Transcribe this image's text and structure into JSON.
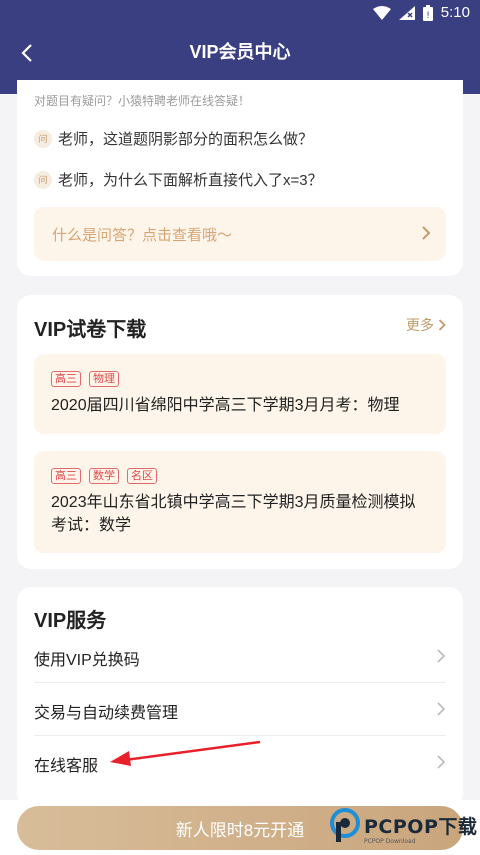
{
  "status_bar": {
    "time": "5:10"
  },
  "navbar": {
    "title": "VIP会员中心"
  },
  "qa": {
    "intro": "对题目有疑问？小猿特聘老师在线答疑！",
    "badge": "问",
    "items": [
      "老师，这道题阴影部分的面积怎么做？",
      "老师，为什么下面解析直接代入了x=3？"
    ],
    "link_text": "什么是问答？点击查看哦～"
  },
  "papers": {
    "title": "VIP试卷下载",
    "more_label": "更多",
    "items": [
      {
        "tags": [
          "高三",
          "物理"
        ],
        "title": "2020届四川省绵阳中学高三下学期3月月考：物理"
      },
      {
        "tags": [
          "高三",
          "数学",
          "名区"
        ],
        "title": "2023年山东省北镇中学高三下学期3月质量检测模拟考试：数学"
      }
    ]
  },
  "services": {
    "title": "VIP服务",
    "items": [
      "使用VIP兑换码",
      "交易与自动续费管理",
      "在线客服"
    ]
  },
  "cta": {
    "label": "新人限时8元开通"
  },
  "watermark": {
    "text": "PCPOP下载",
    "sub": "PCPOP Download"
  },
  "colors": {
    "navbar": "#3a3f82",
    "accent": "#c29a6b",
    "tag": "#e04848",
    "annotation_arrow": "#e8202a"
  }
}
